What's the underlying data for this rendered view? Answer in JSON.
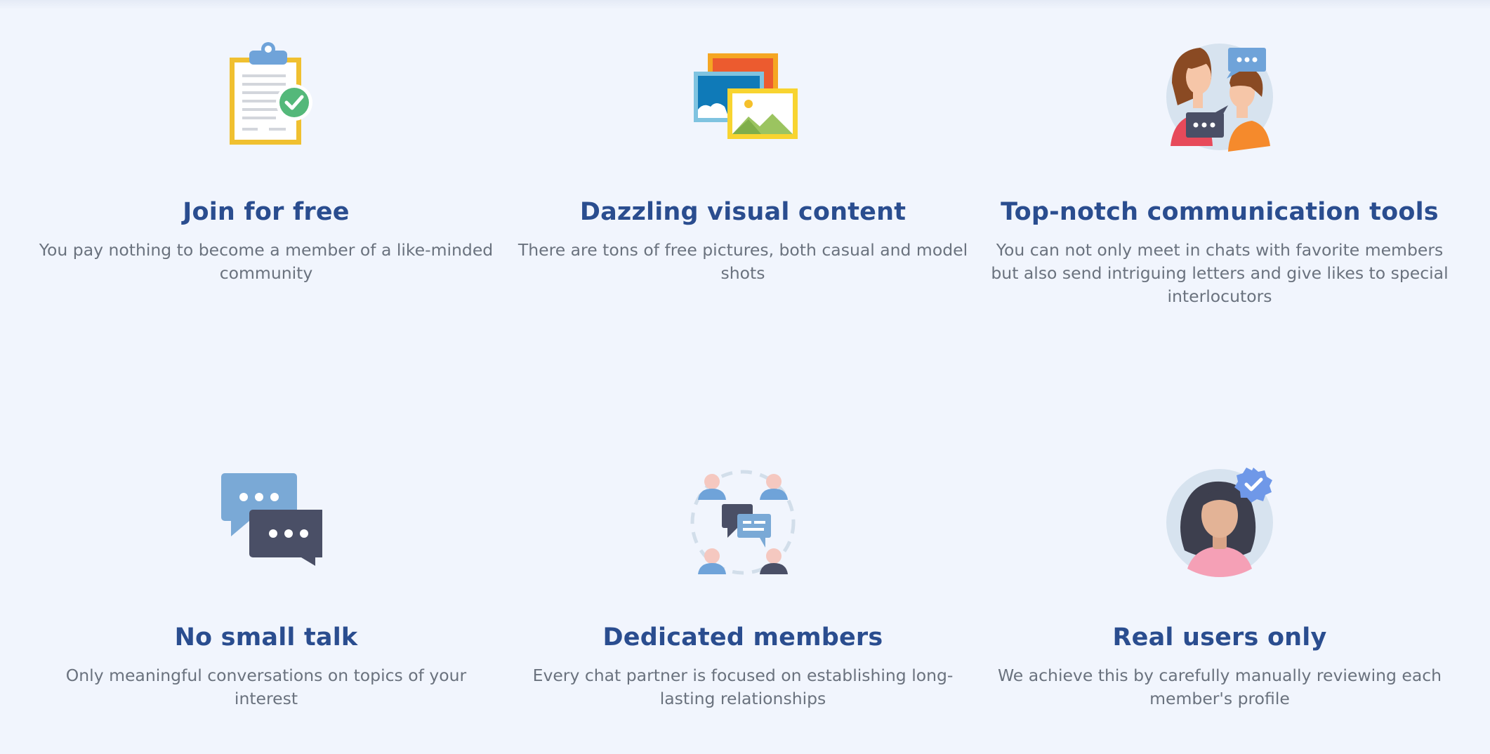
{
  "features": [
    {
      "icon": "clipboard-check-icon",
      "title": "Join for free",
      "text": "You pay nothing to become a member of a like-minded community"
    },
    {
      "icon": "pictures-icon",
      "title": "Dazzling visual content",
      "text": "There are tons of free pictures, both casual and model shots"
    },
    {
      "icon": "conversation-people-icon",
      "title": "Top-notch communication tools",
      "text": "You can not only meet in chats with favorite members but also send intriguing letters and give likes to special interlocutors"
    },
    {
      "icon": "chat-bubbles-icon",
      "title": "No small talk",
      "text": "Only meaningful conversations on topics of your interest"
    },
    {
      "icon": "members-network-icon",
      "title": "Dedicated members",
      "text": "Every chat partner is focused on establishing long-lasting relationships"
    },
    {
      "icon": "verified-user-icon",
      "title": "Real users only",
      "text": "We achieve this by carefully manually reviewing each member's profile"
    }
  ],
  "colors": {
    "background": "#f1f5fd",
    "title": "#2a4d8f",
    "text": "#6a727e"
  }
}
